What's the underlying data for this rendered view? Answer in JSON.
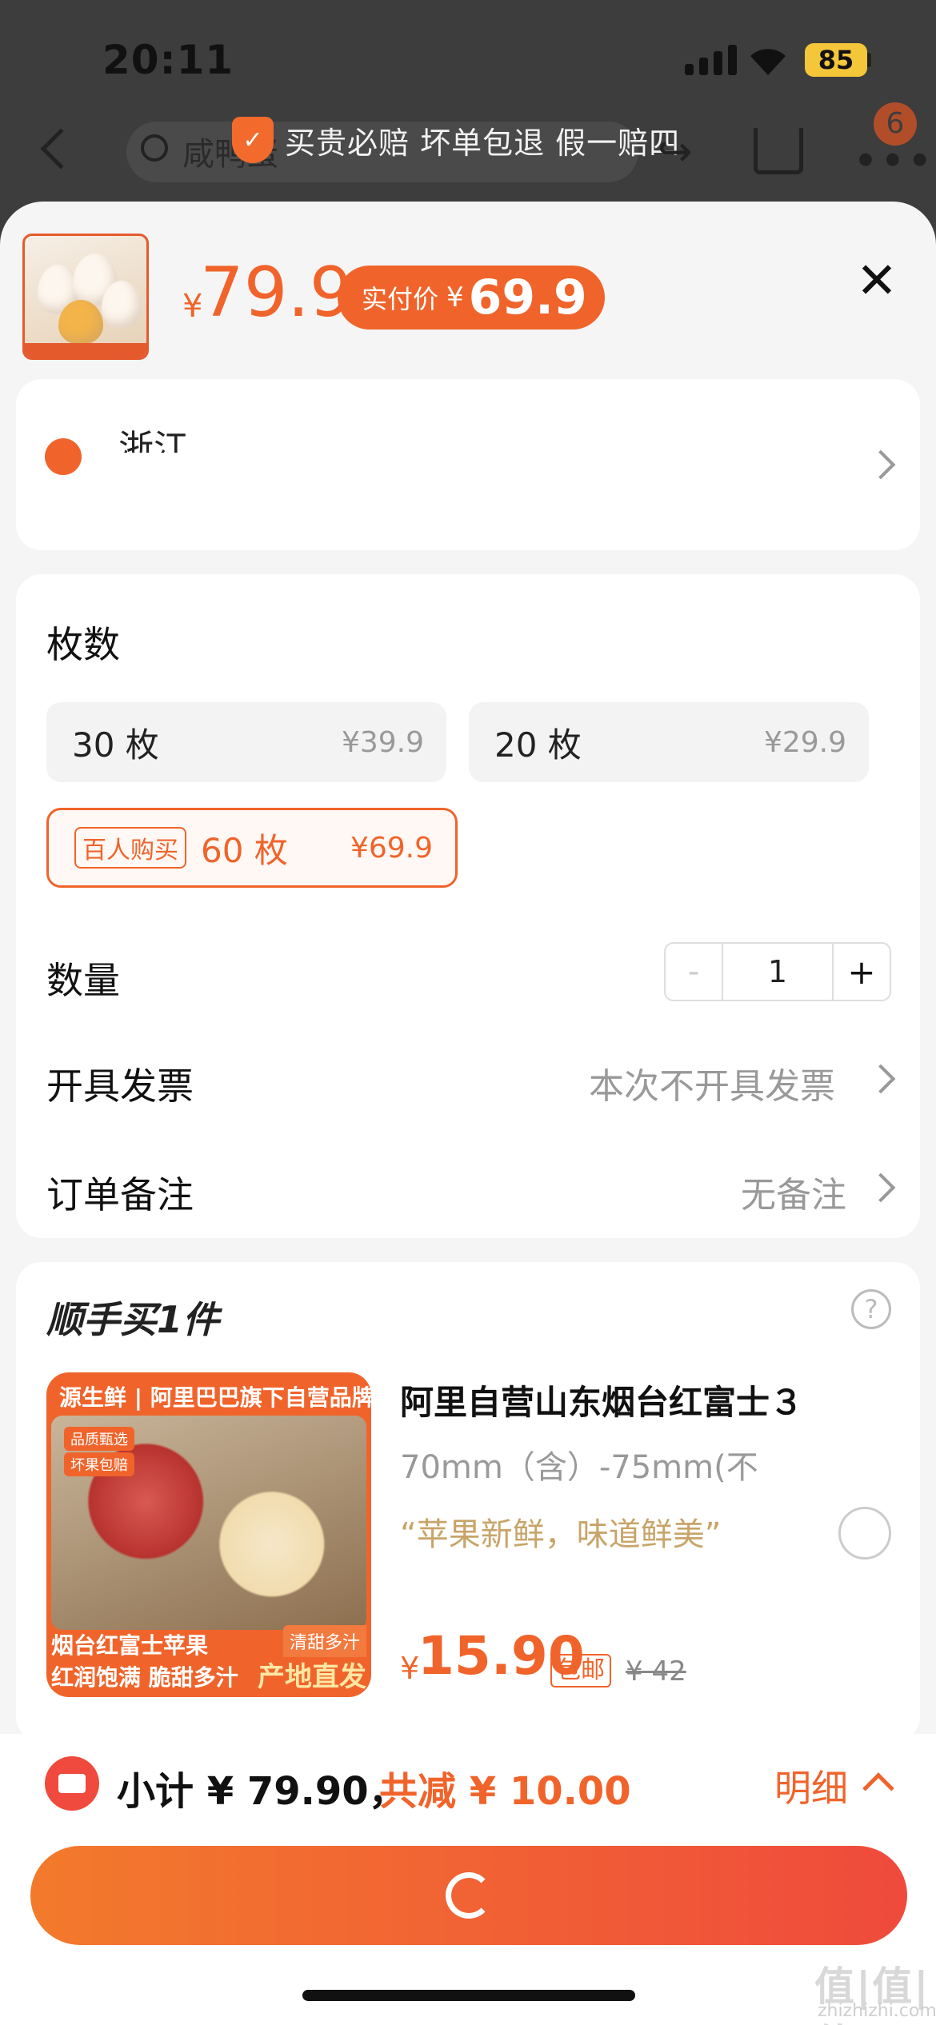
{
  "status_bar": {
    "time": "20:11",
    "battery": "85"
  },
  "background": {
    "search_placeholder": "咸鸭蛋",
    "cart_badge": "6"
  },
  "guarantee": {
    "text": "买贵必赔 坏单包退 假一赔四"
  },
  "product": {
    "price_symbol": "¥",
    "price": "79.9",
    "paid_label": "实付价",
    "paid_price": "69.9"
  },
  "address": {
    "text": "浙江 ..."
  },
  "spec": {
    "title": "枚数",
    "options": [
      {
        "name": "30 枚",
        "price": "¥39.9"
      },
      {
        "name": "20 枚",
        "price": "¥29.9"
      },
      {
        "tag": "百人购买",
        "name": "60 枚",
        "price": "¥69.9",
        "selected": true
      }
    ]
  },
  "quantity": {
    "label": "数量",
    "value": "1",
    "minus": "-",
    "plus": "+"
  },
  "invoice": {
    "label": "开具发票",
    "value": "本次不开具发票"
  },
  "remark": {
    "label": "订单备注",
    "value": "无备注"
  },
  "addon": {
    "title": "顺手买1件",
    "image": {
      "brand": "源生鲜 | 阿里巴巴旗下自营品牌",
      "tag1": "品质甄选",
      "tag2": "坏果包赔",
      "line1": "烟台红富士苹果",
      "line2": "红润饱满 脆甜多汁",
      "r1": "清甜多汁",
      "r2": "产地直发"
    },
    "name": "阿里自营山东烟台红富士３",
    "spec": "70mm（含）-75mm(不",
    "quote": "“苹果新鲜，味道鲜美”",
    "price_symbol": "¥",
    "price": "15.90",
    "free_shipping": "包邮",
    "original_price": "¥ 42"
  },
  "footer": {
    "subtotal": "小计 ¥ 79.90，",
    "discount": "共减 ¥ 10.00",
    "detail": "明细"
  },
  "watermark": {
    "main": "值|值|值",
    "url": "zhizhizhi.com"
  },
  "colors": {
    "accent": "#f0642b",
    "submit_start": "#f37a2c",
    "submit_end": "#ef4a3c"
  }
}
